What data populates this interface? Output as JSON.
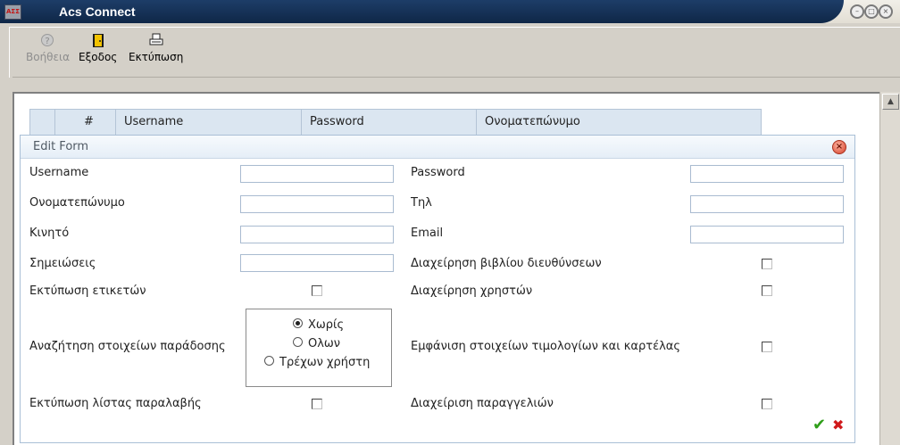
{
  "window": {
    "title": "Acs Connect",
    "app_icon_text": "ΑΣΣ",
    "brand_color": "#1d3d68"
  },
  "toolbar": {
    "help_label": "Βοήθεια",
    "exit_label": "Εξοδος",
    "print_label": "Εκτύπωση"
  },
  "grid": {
    "columns": [
      "#",
      "Username",
      "Password",
      "Ονοματεπώνυμο"
    ]
  },
  "form": {
    "title": "Edit Form",
    "fields": {
      "username": {
        "label": "Username",
        "value": ""
      },
      "password": {
        "label": "Password",
        "value": ""
      },
      "fullname": {
        "label": "Ονοματεπώνυμο",
        "value": ""
      },
      "phone": {
        "label": "Τηλ",
        "value": ""
      },
      "mobile": {
        "label": "Κινητό",
        "value": ""
      },
      "email": {
        "label": "Email",
        "value": ""
      },
      "notes": {
        "label": "Σημειώσεις",
        "value": ""
      }
    },
    "checkboxes": {
      "address_book": {
        "label": "Διαχείρηση βιβλίου διευθύνσεων",
        "checked": false
      },
      "print_labels": {
        "label": "Εκτύπωση ετικετών",
        "checked": false
      },
      "manage_users": {
        "label": "Διαχείρηση χρηστών",
        "checked": false
      },
      "invoices": {
        "label": "Εμφάνιση στοιχείων τιμολογίων και καρτέλας",
        "checked": false
      },
      "print_receipt": {
        "label": "Εκτύπωση λίστας παραλαβής",
        "checked": false
      },
      "orders": {
        "label": "Διαχείριση παραγγελιών",
        "checked": false
      }
    },
    "delivery_search": {
      "label": "Αναζήτηση στοιχείων παράδοσης",
      "options": [
        "Χωρίς",
        "Ολων",
        "Τρέχων χρήστη"
      ],
      "selected": "Χωρίς"
    },
    "ok_icon": "check-icon",
    "cancel_icon": "cross-icon"
  }
}
